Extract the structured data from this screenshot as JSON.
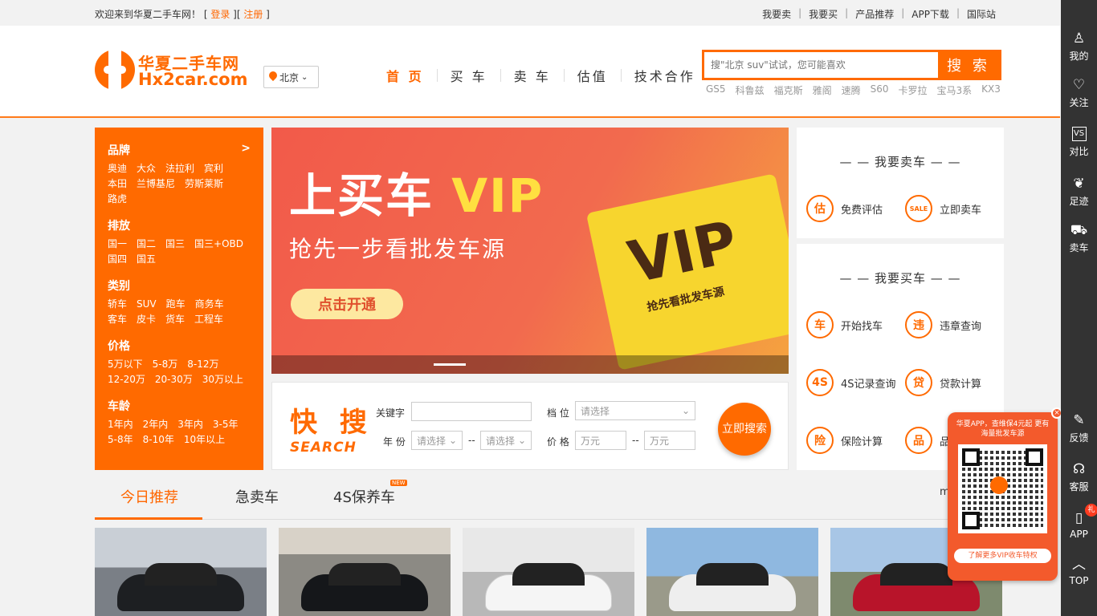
{
  "topbar": {
    "welcome": "欢迎来到华夏二手车网！",
    "login": "登录",
    "register": "注册",
    "links": [
      "我要卖",
      "我要买",
      "产品推荐",
      "APP下载",
      "国际站"
    ]
  },
  "header": {
    "logo_cn": "华夏二手车网",
    "logo_en": "Hx2car.com",
    "city": "北京",
    "nav": [
      "首 页",
      "买 车",
      "卖 车",
      "估值",
      "技术合作"
    ],
    "search_placeholder": "搜\"北京 suv\"试试，您可能喜欢",
    "search_button": "搜 索",
    "hotwords": [
      "GS5",
      "科鲁兹",
      "福克斯",
      "雅阁",
      "速腾",
      "S60",
      "卡罗拉",
      "宝马3系",
      "KX3"
    ]
  },
  "filter": {
    "more": ">",
    "sections": [
      {
        "title": "品牌",
        "options": [
          "奥迪",
          "大众",
          "法拉利",
          "宾利",
          "本田",
          "兰博基尼",
          "劳斯莱斯",
          "路虎"
        ]
      },
      {
        "title": "排放",
        "options": [
          "国一",
          "国二",
          "国三",
          "国三+OBD",
          "国四",
          "国五"
        ]
      },
      {
        "title": "类别",
        "options": [
          "轿车",
          "SUV",
          "跑车",
          "商务车",
          "客车",
          "皮卡",
          "货车",
          "工程车"
        ]
      },
      {
        "title": "价格",
        "options": [
          "5万以下",
          "5-8万",
          "8-12万",
          "12-20万",
          "20-30万",
          "30万以上"
        ]
      },
      {
        "title": "车龄",
        "options": [
          "1年内",
          "2年内",
          "3年内",
          "3-5年",
          "5-8年",
          "8-10年",
          "10年以上"
        ]
      }
    ]
  },
  "banner": {
    "title_a": "上买车",
    "title_b": "VIP",
    "subtitle": "抢先一步看批发车源",
    "cta": "点击开通",
    "ticket_big": "VIP",
    "ticket_sub": "抢先看批发车源"
  },
  "quick_search": {
    "logo_cn": "快 搜",
    "logo_en": "SEARCH",
    "keyword_label": "关键字",
    "gear_label": "档 位",
    "gear_placeholder": "请选择",
    "year_label": "年 份",
    "year_from": "请选择",
    "year_to": "请选择",
    "price_label": "价 格",
    "price_from": "万元",
    "price_to": "万元",
    "dash": "--",
    "button": "立即搜索"
  },
  "sell": {
    "title": "— — 我要卖车 — —",
    "items": [
      {
        "label": "免费评估",
        "icon": "估"
      },
      {
        "label": "立即卖车",
        "icon": "SALE"
      }
    ]
  },
  "buy": {
    "title": "— — 我要买车 — —",
    "items": [
      {
        "label": "开始找车",
        "icon": "车"
      },
      {
        "label": "违章查询",
        "icon": "违"
      },
      {
        "label": "4S记录查询",
        "icon": "4S"
      },
      {
        "label": "贷款计算",
        "icon": "贷"
      },
      {
        "label": "保险计算",
        "icon": "险"
      },
      {
        "label": "品",
        "icon": "品"
      }
    ]
  },
  "tabs": {
    "items": [
      "今日推荐",
      "急卖车",
      "4S保养车"
    ],
    "new_badge": "NEW",
    "more": "m"
  },
  "rail": [
    {
      "label": "我的",
      "icon": "user-icon",
      "glyph": "♙"
    },
    {
      "label": "关注",
      "icon": "heart-icon",
      "glyph": "♡"
    },
    {
      "label": "对比",
      "icon": "compare-icon",
      "glyph": "VS"
    },
    {
      "label": "足迹",
      "icon": "footprint-icon",
      "glyph": "❦"
    },
    {
      "label": "卖车",
      "icon": "car-icon",
      "glyph": "⛟"
    },
    {
      "label": "反馈",
      "icon": "edit-icon",
      "glyph": "✎"
    },
    {
      "label": "客服",
      "icon": "headset-icon",
      "glyph": "☊"
    },
    {
      "label": "APP",
      "icon": "phone-icon",
      "glyph": "▯",
      "badge": "礼"
    },
    {
      "label": "TOP",
      "icon": "arrow-up-icon",
      "glyph": "︿"
    }
  ],
  "qr_popup": {
    "text": "华夏APP，查维保4元起 更有海量批发车源",
    "footer": "了解更多VIP收车特权",
    "close": "×"
  },
  "colors": {
    "accent": "#ff6a00",
    "rail": "#333333"
  }
}
